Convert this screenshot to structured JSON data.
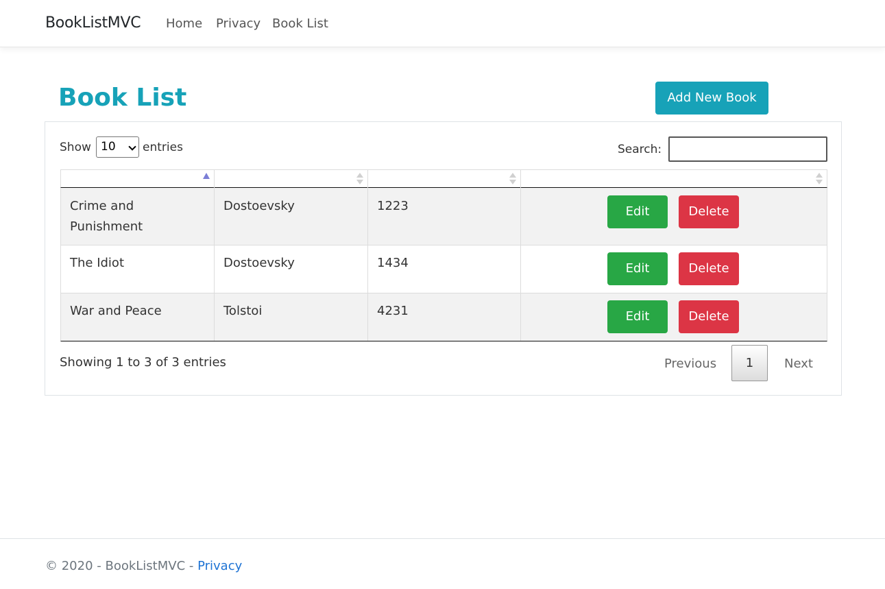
{
  "navbar": {
    "brand": "BookListMVC",
    "links": [
      "Home",
      "Privacy",
      "Book List"
    ]
  },
  "page": {
    "title": "Book List",
    "add_button": "Add New Book"
  },
  "table_controls": {
    "show_label": "Show",
    "entries_value": "10",
    "entries_label": "entries",
    "search_label": "Search:",
    "search_value": ""
  },
  "table": {
    "headers": [
      "",
      "",
      "",
      ""
    ],
    "rows": [
      {
        "name": "Crime and Punishment",
        "author": "Dostoevsky",
        "isbn": "1223",
        "edit": "Edit",
        "delete": "Delete"
      },
      {
        "name": "The Idiot",
        "author": "Dostoevsky",
        "isbn": "1434",
        "edit": "Edit",
        "delete": "Delete"
      },
      {
        "name": "War and Peace",
        "author": "Tolstoi",
        "isbn": "4231",
        "edit": "Edit",
        "delete": "Delete"
      }
    ]
  },
  "pagination": {
    "info": "Showing 1 to 3 of 3 entries",
    "previous": "Previous",
    "current_page": "1",
    "next": "Next"
  },
  "footer": {
    "text": "© 2020 - BookListMVC - ",
    "link": "Privacy"
  },
  "colors": {
    "accent": "#17a2b8",
    "edit": "#28a745",
    "delete": "#dc3545",
    "link": "#1e73d4"
  }
}
